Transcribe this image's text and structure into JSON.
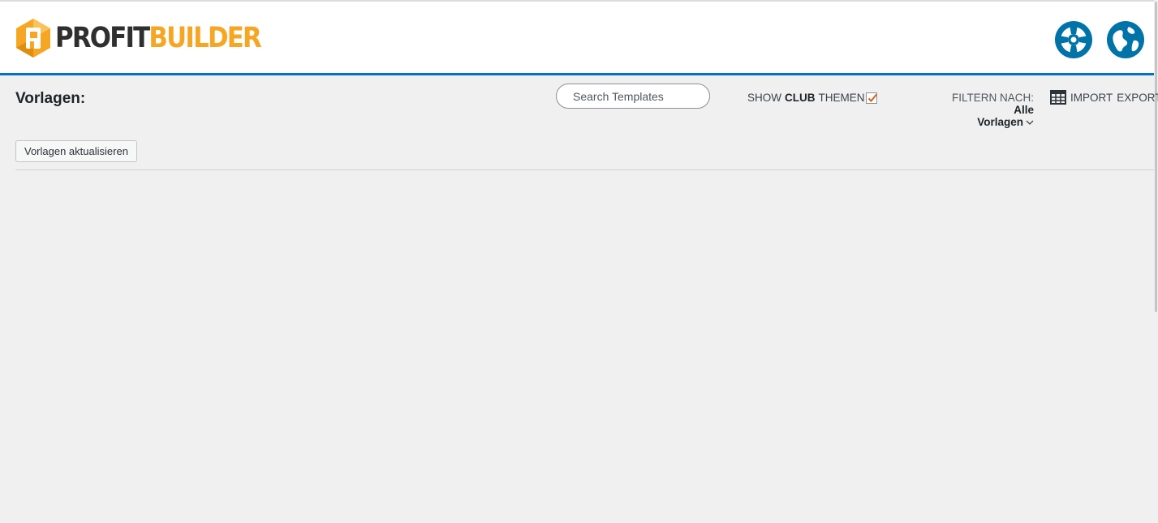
{
  "brand": {
    "part1": "PROFIT",
    "part2": "BUILDER",
    "accent_color": "#f6a623",
    "dark_color": "#2f2f2f",
    "header_border_color": "#0073c0"
  },
  "header_icons": [
    {
      "name": "help-icon",
      "color": "#0073a8"
    },
    {
      "name": "globe-icon",
      "color": "#0073a8"
    }
  ],
  "toolbar": {
    "title": "Vorlagen:",
    "search_placeholder": "Search Templates",
    "club": {
      "prefix": "SHOW",
      "bold": "CLUB",
      "suffix": "THEMEN",
      "checked": true
    },
    "filter": {
      "label": "FILTERN NACH:",
      "value_line1": "Alle",
      "value_line2": "Vorlagen"
    },
    "import_label": "IMPORT",
    "export_label": "EXPORT"
  },
  "actions": {
    "refresh_label": "Vorlagen aktualisieren"
  }
}
